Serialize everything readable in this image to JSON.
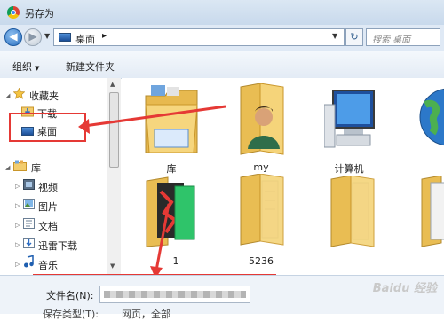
{
  "window": {
    "title": "另存为"
  },
  "address": {
    "location": "桌面",
    "separator": "▸",
    "back_glyph": "◀",
    "forward_glyph": "▶",
    "search_placeholder": "搜索 桌面"
  },
  "toolbar": {
    "organize_label": "组织",
    "new_folder_label": "新建文件夹"
  },
  "sidebar": {
    "favorites_label": "收藏夹",
    "downloads_label": "下载",
    "desktop_label": "桌面",
    "libraries_label": "库",
    "library_items": [
      "视频",
      "图片",
      "文档",
      "迅雷下载",
      "音乐"
    ]
  },
  "files": [
    {
      "name": "库",
      "icon": "library-folder-icon"
    },
    {
      "name": "my",
      "icon": "user-folder-icon"
    },
    {
      "name": "计算机",
      "icon": "computer-icon"
    },
    {
      "name": "",
      "icon": "network-globe-icon"
    },
    {
      "name": "1",
      "icon": "folder-icon"
    },
    {
      "name": "5236",
      "icon": "folder-icon"
    },
    {
      "name": "",
      "icon": "folder-icon"
    },
    {
      "name": "",
      "icon": "folder-icon"
    },
    {
      "name": "",
      "icon": "folder-icon"
    }
  ],
  "footer": {
    "filename_label": "文件名(N):",
    "type_label": "保存类型(T):",
    "type_value": "网页，全部"
  },
  "watermark": "Baidu 经验",
  "colors": {
    "annotation_red": "#e53935",
    "folder_yellow": "#f3cd6e"
  }
}
